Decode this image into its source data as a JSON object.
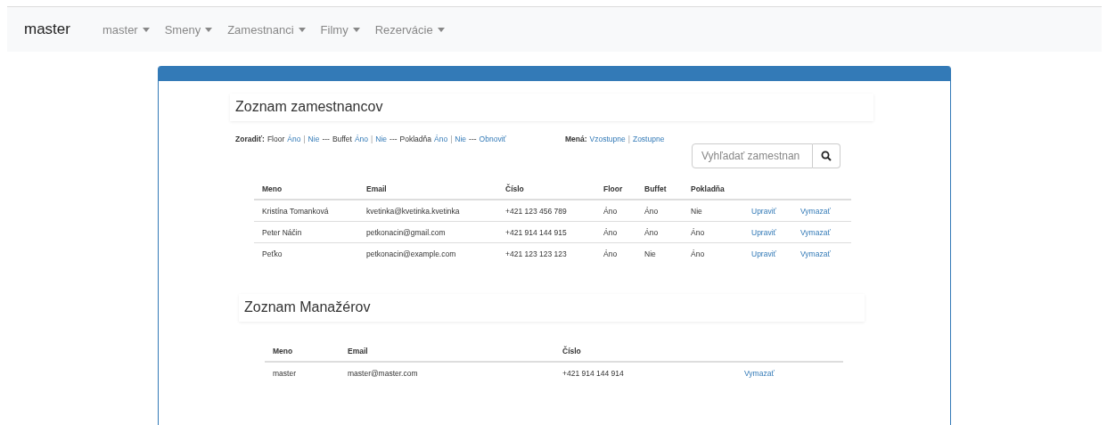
{
  "navbar": {
    "brand": "master",
    "menus": [
      {
        "label": "master"
      },
      {
        "label": "Smeny"
      },
      {
        "label": "Zamestnanci"
      },
      {
        "label": "Filmy"
      },
      {
        "label": "Rezervácie"
      }
    ]
  },
  "employees": {
    "title": "Zoznam zamestnancov",
    "sort": {
      "label": "Zoradiť:",
      "parts": [
        {
          "kind": "text",
          "text": "Floor"
        },
        {
          "kind": "link",
          "text": "Áno"
        },
        {
          "kind": "sep",
          "text": "|"
        },
        {
          "kind": "link",
          "text": "Nie"
        },
        {
          "kind": "text",
          "text": "---"
        },
        {
          "kind": "text",
          "text": "Buffet"
        },
        {
          "kind": "link",
          "text": "Áno"
        },
        {
          "kind": "sep",
          "text": "|"
        },
        {
          "kind": "link",
          "text": "Nie"
        },
        {
          "kind": "text",
          "text": "---"
        },
        {
          "kind": "text",
          "text": "Pokladňa"
        },
        {
          "kind": "link",
          "text": "Áno"
        },
        {
          "kind": "sep",
          "text": "|"
        },
        {
          "kind": "link",
          "text": "Nie"
        },
        {
          "kind": "text",
          "text": "---"
        },
        {
          "kind": "link",
          "text": "Obnoviť"
        }
      ]
    },
    "name_sort": {
      "label": "Mená:",
      "parts": [
        {
          "kind": "link",
          "text": "Vzostupne"
        },
        {
          "kind": "sep",
          "text": "|"
        },
        {
          "kind": "link",
          "text": "Zostupne"
        }
      ]
    },
    "search": {
      "placeholder": "Vyhľadať zamestnan"
    },
    "table": {
      "columns": [
        "Meno",
        "Email",
        "Číslo",
        "Floor",
        "Buffet",
        "Pokladňa"
      ],
      "rows": [
        {
          "cells": [
            "Kristína Tomanková",
            "kvetinka@kvetinka.kvetinka",
            "+421 123 456 789",
            "Áno",
            "Áno",
            "Nie"
          ],
          "actions": [
            "Upraviť",
            "Vymazať"
          ]
        },
        {
          "cells": [
            "Peter Náčin",
            "petkonacin@gmail.com",
            "+421 914 144 915",
            "Áno",
            "Áno",
            "Áno"
          ],
          "actions": [
            "Upraviť",
            "Vymazať"
          ]
        },
        {
          "cells": [
            "Peťko",
            "petkonacin@example.com",
            "+421 123 123 123",
            "Áno",
            "Nie",
            "Áno"
          ],
          "actions": [
            "Upraviť",
            "Vymazať"
          ]
        }
      ]
    }
  },
  "managers": {
    "title": "Zoznam Manažérov",
    "table": {
      "columns": [
        "Meno",
        "Email",
        "Číslo"
      ],
      "rows": [
        {
          "cells": [
            "master",
            "master@master.com",
            "+421 914 144 914"
          ],
          "actions": [
            "Vymazať"
          ]
        }
      ]
    }
  }
}
